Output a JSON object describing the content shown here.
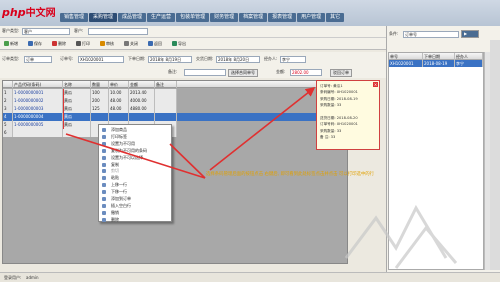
{
  "logo": {
    "php": "php",
    "cn": "中文网"
  },
  "menu": [
    "销售管理",
    "采购管理",
    "成品管理",
    "生产运营",
    "包装单管理",
    "财务管理",
    "档案管理",
    "报表管理",
    "用户管理",
    "其它"
  ],
  "menu_active": 1,
  "toolbar": {
    "customer_label": "客户类型:",
    "customer_value": "客户",
    "customer2_label": "客户:",
    "buttons": [
      "新增",
      "保存",
      "删除",
      "打印",
      "审核",
      "关闭",
      "返回",
      "导出"
    ]
  },
  "order": {
    "type_label": "订单类型:",
    "type_value": "订单",
    "no_label": "订单号:",
    "no_value": "XH1020001",
    "date_label": "下单日期:",
    "date_value": "2018年 8月19日",
    "delivery_label": "交货日期:",
    "delivery_value": "2018年 8月20日",
    "op_label": "经办人:",
    "op_value": "李宁",
    "remark_label": "备注:",
    "contract_btn": "选择合同单号",
    "total_label": "金额:",
    "total_value": "2802.00",
    "reject_btn": "驳回订单"
  },
  "grid": {
    "columns": [
      "",
      "产品代码(条码)",
      "名称",
      "数量",
      "单价",
      "金额",
      "备注"
    ],
    "rows": [
      {
        "marker": "1",
        "code": "1-0000000001",
        "name": "黄瓜",
        "qty": "100",
        "price": "10.00",
        "amount": "2013.40",
        "note": ""
      },
      {
        "marker": "2",
        "code": "1-0000000002",
        "name": "黄瓜",
        "qty": "200",
        "price": "48.00",
        "amount": "4000.00",
        "note": ""
      },
      {
        "marker": "3",
        "code": "1-0000000003",
        "name": "黄瓜",
        "qty": "125",
        "price": "48.00",
        "amount": "4880.00",
        "note": ""
      },
      {
        "marker": "4",
        "code": "1-0000000004",
        "name": "黄瓜",
        "qty": "",
        "price": "",
        "amount": "",
        "note": ""
      },
      {
        "marker": "5",
        "code": "1-0000000005",
        "name": "黄瓜",
        "qty": "",
        "price": "",
        "amount": "",
        "note": ""
      },
      {
        "marker": "6",
        "code": "",
        "name": "",
        "qty": "",
        "price": "",
        "amount": "",
        "note": ""
      }
    ],
    "selected_row": 3
  },
  "context_menu": {
    "items": [
      "添加商品",
      "打印标签",
      "设置为不可用",
      "复制为不可用的条码",
      "设置为不可以选择",
      "复制",
      "剪切",
      "粘贴",
      "上移一行",
      "下移一行",
      "添加到订单",
      "插入空白行",
      "撤销",
      "删除"
    ],
    "disabled": [
      6
    ]
  },
  "card": {
    "lines": [
      "订单号: 黄瓜1",
      "条码编号: XH1020001",
      "采购日期: 2018-08-19",
      "采购数量: 33",
      "",
      "送货日期: 2018-08-20",
      "订单号码: XH1020001",
      "采购数量: 33",
      "备 注: 33"
    ]
  },
  "right_panel": {
    "label": "条件:",
    "value": "订单号",
    "columns": [
      "单号",
      "下单日期",
      "经办人"
    ],
    "first_row": [
      "XH1020001",
      "2018-08-19",
      "李宁"
    ]
  },
  "annotation": "选择条码管理后面的按钮点击 右键后, 即可看到此处标签点击并点击 可以打印选中的行",
  "status": {
    "user_label": "登录用户:",
    "user": "admin"
  },
  "colors": {
    "accent": "#d9001b",
    "menu": "#4a6c92",
    "selection": "#3a72c4",
    "annotation": "#e0a000",
    "arrow": "#e03030"
  }
}
